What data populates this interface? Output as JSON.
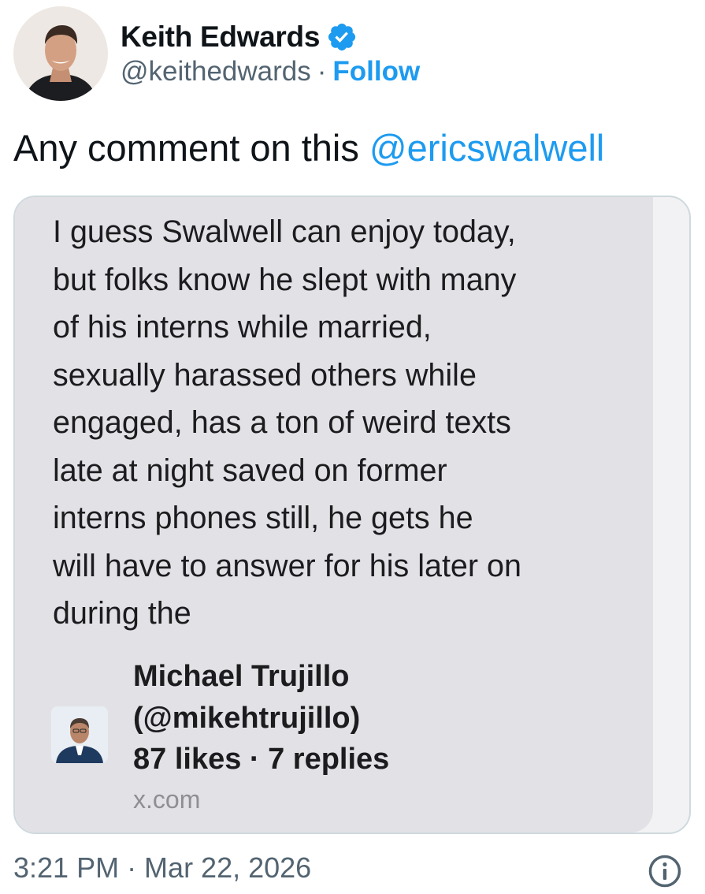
{
  "author": {
    "display_name": "Keith Edwards",
    "handle": "@keithedwards",
    "separator": "·",
    "follow_label": "Follow",
    "verified_color": "#1d9bf0"
  },
  "tweet": {
    "text_prefix": "Any comment on this ",
    "mention": "@ericswalwell"
  },
  "quoted_card": {
    "lines": [
      "I guess Swalwell can enjoy today,",
      "but folks know he slept with many",
      "of his interns while married,",
      "sexually harassed others while",
      "engaged, has a ton of weird texts",
      "late at night saved on former",
      "interns phones still, he gets he",
      "will have to answer for his later on",
      "during the"
    ],
    "author_name": "Michael Trujillo",
    "author_handle": "(@mikehtrujillo)",
    "stats": "87 likes · 7 replies",
    "domain": "x.com"
  },
  "footer": {
    "timestamp": "3:21 PM · Mar 22, 2026",
    "info_icon": "info-icon"
  },
  "colors": {
    "link": "#1d9bf0",
    "secondary_text": "#536471",
    "card_background": "#e2e2e6",
    "card_border": "#cfd9de"
  }
}
